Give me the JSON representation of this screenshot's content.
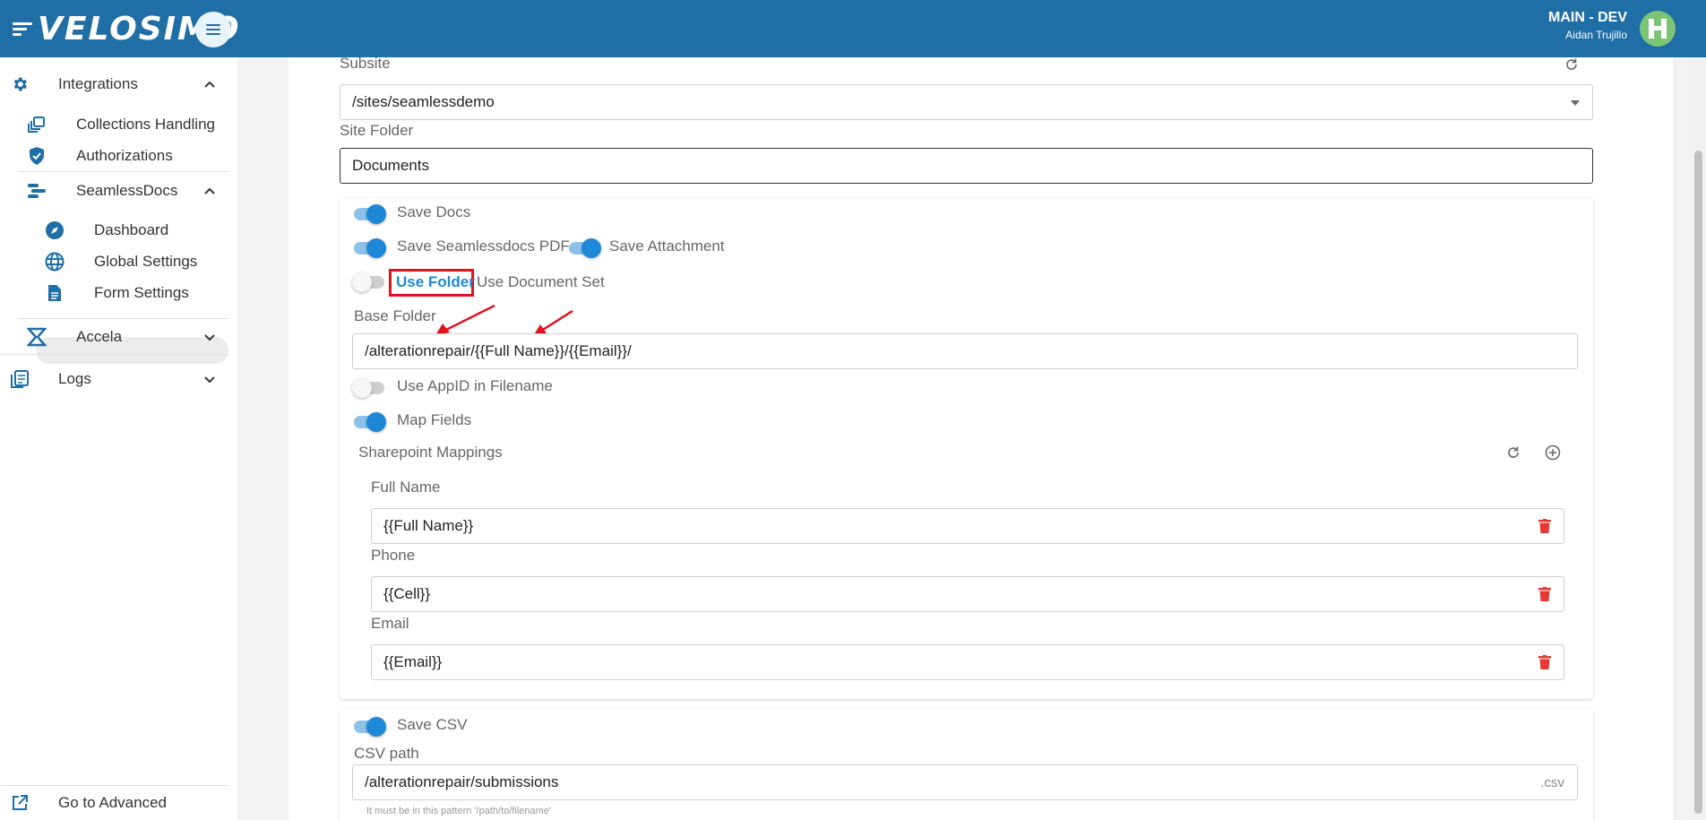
{
  "header": {
    "logo": "VELOSIMO",
    "environment": "MAIN - DEV",
    "user": "Aidan Trujillo"
  },
  "sidebar": {
    "integrations": "Integrations",
    "collections_handling": "Collections Handling",
    "authorizations": "Authorizations",
    "seamlessdocs": "SeamlessDocs",
    "dashboard": "Dashboard",
    "global_settings": "Global Settings",
    "form_settings": "Form Settings",
    "accela": "Accela",
    "logs": "Logs",
    "go_to_advanced": "Go to Advanced"
  },
  "form": {
    "subsite_label": "Subsite",
    "subsite_value": "/sites/seamlessdemo",
    "site_folder_label": "Site Folder",
    "site_folder_value": "Documents",
    "save_docs": "Save Docs",
    "save_seamlessdocs_pdf": "Save Seamlessdocs PDF",
    "save_attachment": "Save Attachment",
    "use_folder": "Use Folder",
    "use_document_set": "Use Document Set",
    "base_folder_label": "Base Folder",
    "base_folder_value": "/alterationrepair/{{Full Name}}/{{Email}}/",
    "use_appid_in_filename": "Use AppID in Filename",
    "map_fields": "Map Fields",
    "sharepoint_mappings": "Sharepoint Mappings",
    "mappings": [
      {
        "label": "Full Name",
        "value": "{{Full Name}}"
      },
      {
        "label": "Phone",
        "value": "{{Cell}}"
      },
      {
        "label": "Email",
        "value": "{{Email}}"
      }
    ],
    "save_csv": "Save CSV",
    "csv_path_label": "CSV path",
    "csv_path_value": "/alterationrepair/submissions",
    "csv_suffix": ".csv",
    "csv_hint": "It must be in this pattern '/path/to/filename'"
  },
  "toggles": {
    "save_docs": true,
    "save_seamlessdocs_pdf": true,
    "save_attachment": true,
    "use_folder_or_document_set": false,
    "use_appid_in_filename": false,
    "map_fields": true,
    "save_csv": true
  },
  "colors": {
    "brand": "#1f6ea6",
    "accent": "#1e88d6",
    "highlight_box": "#e0141e",
    "delete": "#e53935"
  }
}
